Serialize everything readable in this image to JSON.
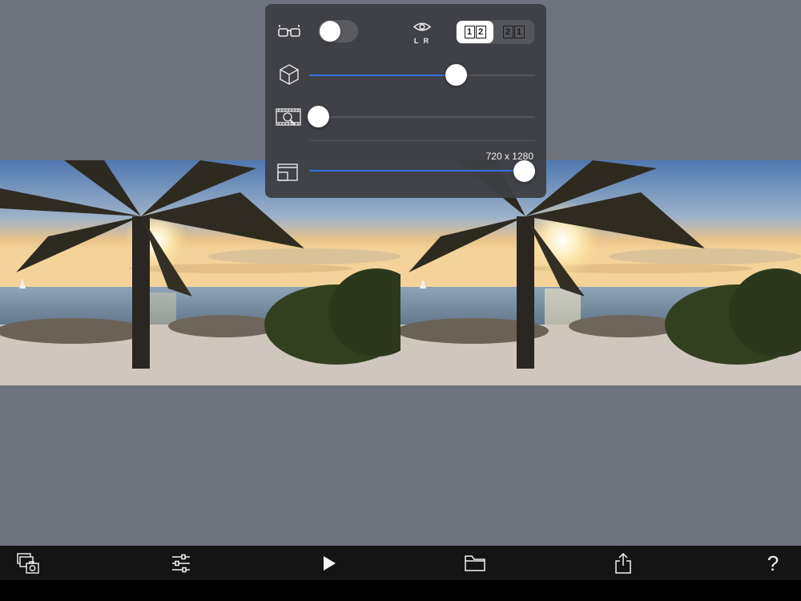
{
  "panel": {
    "anaglyph_toggle": {
      "on": false
    },
    "view_mode_label": "L R",
    "order_options": [
      "12",
      "21"
    ],
    "selected_order": "12",
    "depth_slider": {
      "level_fraction": 0.66
    },
    "zoom_slider": {
      "level_fraction": 0.0
    },
    "resolution_label": "720 x 1280",
    "size_slider": {
      "level_fraction": 0.97
    }
  },
  "toolbar": {
    "items": [
      "photo-library-icon",
      "sliders-icon",
      "play-icon",
      "folder-icon",
      "share-icon",
      "help-icon"
    ],
    "help_label": "?"
  },
  "colors": {
    "background": "#6f737d",
    "panel": "#3e3f44",
    "accent": "#2f6fe0",
    "toolbar": "#141414"
  }
}
